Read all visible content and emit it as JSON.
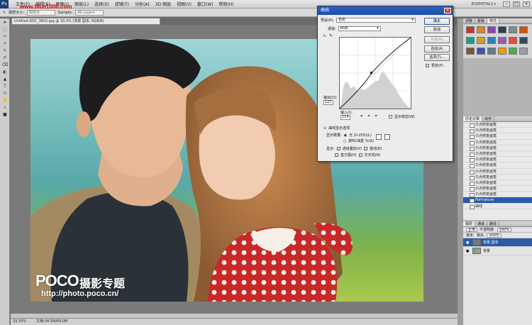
{
  "watermark_site": "www.blue1000.com",
  "menubar": {
    "logo": "Ps",
    "items": [
      "文件(F)",
      "编辑(E)",
      "图像(I)",
      "图层(L)",
      "选择(S)",
      "滤镜(T)",
      "分析(A)",
      "3D 图层",
      "视图(V)",
      "窗口(W)",
      "帮助(H)"
    ],
    "workspace": "ESSENTIALS ▾",
    "minimize": "–",
    "maximize": "□",
    "close": "×"
  },
  "options": {
    "tool_icon": "✎",
    "size_label": "取样大小:",
    "size_value": "取样点",
    "sample_label": "Sample:",
    "sample_value": "All Layers"
  },
  "document": {
    "tab_title": "Untitled-DSC_3602.jpg @ 33.3% (背景 副本, RGB/8)",
    "zoom": "33.33%",
    "doc_size": "文档:34.5M/69.0M"
  },
  "photo": {
    "brand": "POCO",
    "title": "摄影专题",
    "url": "http://photo.poco.cn/"
  },
  "tools": [
    "➤",
    "⬚",
    "✂",
    "⌖",
    "✎",
    "✐",
    "⌫",
    "◐",
    "▲",
    "T",
    "⬭",
    "✋",
    "⌕",
    "■"
  ],
  "curves": {
    "title": "曲线",
    "close": "×",
    "preset_label": "预设(R):",
    "preset_value": "自定",
    "channel_label": "通道:",
    "channel_value": "RGB",
    "output_label": "输出(O):",
    "output_value": "127",
    "input_label": "输入(I):",
    "input_value": "114",
    "buttons": {
      "ok": "确定",
      "cancel": "取消",
      "smooth": "平滑(M)",
      "auto": "自动(A)",
      "options": "选项(T)..."
    },
    "preview_label": "预览(P)",
    "show_clipping": "显示修剪(W)",
    "display_options": "曲线显示选项",
    "show_amount_label": "显示数量:",
    "light_option": "光 (0-255)(L)",
    "pigment_option": "颜料/油墨 %(G)",
    "show_label": "显示:",
    "channel_overlays": "通道叠加(V)",
    "baseline": "基线(B)",
    "histogram": "直方图(H)",
    "intersection": "交叉线(N)"
  },
  "panels": {
    "swatch_tabs": [
      "调整",
      "蒙版",
      "样式"
    ],
    "history_tabs": [
      "历史记录",
      "动作"
    ],
    "history_items": [
      "只点修复画笔",
      "只点修复画笔",
      "只点修复画笔",
      "只点修复画笔",
      "只点修复画笔",
      "只点修复画笔",
      "只点修复画笔",
      "只点修复画笔",
      "只点修复画笔",
      "只点修复画笔",
      "只点修复画笔",
      "只点修复画笔",
      "只点修复画笔",
      "Portraiture",
      "曲线"
    ],
    "history_selected_index": 13,
    "layer_tabs": [
      "图层",
      "通道",
      "路径"
    ],
    "blend_mode": "正常",
    "opacity_label": "不透明度:",
    "opacity": "100%",
    "lock_label": "锁定:",
    "fill_label": "填充:",
    "fill": "100%",
    "layers": [
      {
        "name": "背景 副本",
        "selected": true
      },
      {
        "name": "背景",
        "selected": false
      }
    ],
    "swatch_colors": [
      "#c0392b",
      "#e67e22",
      "#8e44ad",
      "#2c3e50",
      "#7f8c8d",
      "#d35400",
      "#16a085",
      "#c9a227",
      "#2980b9",
      "#9b59b6",
      "#e74c3c",
      "#34495e",
      "#795548",
      "#3f51b5",
      "#607d8b",
      "#ff9800",
      "#4caf50",
      "#9e9e9e"
    ]
  }
}
